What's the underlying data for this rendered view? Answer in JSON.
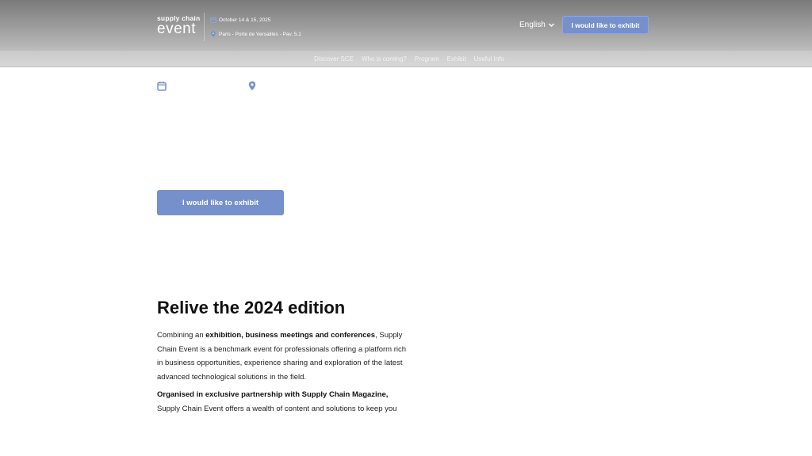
{
  "header": {
    "logo": {
      "line1": "supply chain",
      "line2": "event"
    },
    "date": "October 14 & 15, 2025",
    "location": "Paris - Porte de Versailles - Pav. 5.1",
    "language": "English",
    "exhibit_button": "I would like to exhibit"
  },
  "nav": {
    "items": [
      {
        "label": "Discover SCE"
      },
      {
        "label": "Who is coming?"
      },
      {
        "label": "Program"
      },
      {
        "label": "Exhibit"
      },
      {
        "label": "Useful Info"
      }
    ]
  },
  "hero": {
    "icons": [
      "calendar-icon",
      "location-pin-icon"
    ],
    "exhibit_button": "I would like to exhibit"
  },
  "about": {
    "title": "Relive the 2024 edition",
    "p1_pre": "Combining an ",
    "p1_bold": "exhibition, business meetings and conferences",
    "p1_post": ", Supply Chain Event is a benchmark event for professionals offering a platform rich in business opportunities, experience sharing and exploration of the latest advanced technological solutions in the field.",
    "p2_bold": "Organised in exclusive partnership with Supply Chain Magazine,",
    "p2_post": " Supply Chain Event offers a wealth of content and solutions to keep you"
  },
  "colors": {
    "accent": "#7690cc",
    "header_gray": "#9e9e9e",
    "nav_gray": "#d0d0d0"
  }
}
